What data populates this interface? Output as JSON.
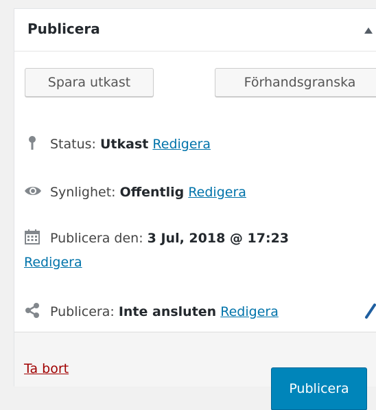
{
  "panel": {
    "title": "Publicera"
  },
  "buttons": {
    "save_draft": "Spara utkast",
    "preview": "Förhandsgranska",
    "publish": "Publicera"
  },
  "status": {
    "label": "Status: ",
    "value": "Utkast",
    "edit": "Redigera"
  },
  "visibility": {
    "label": "Synlighet: ",
    "value": "Offentlig",
    "edit": "Redigera"
  },
  "publish_date": {
    "label": "Publicera den: ",
    "value": "3 Jul, 2018 @ 17:23",
    "edit": "Redigera"
  },
  "sharing": {
    "label": "Publicera: ",
    "value": "Inte ansluten",
    "edit": "Redigera"
  },
  "footer": {
    "trash": "Ta bort"
  },
  "colors": {
    "primary": "#0085ba",
    "link": "#0073aa",
    "delete": "#a00000"
  },
  "icons": {
    "status": "pin-icon",
    "visibility": "eye-icon",
    "date": "calendar-icon",
    "sharing": "share-icon",
    "toggle": "triangle-up-icon"
  }
}
